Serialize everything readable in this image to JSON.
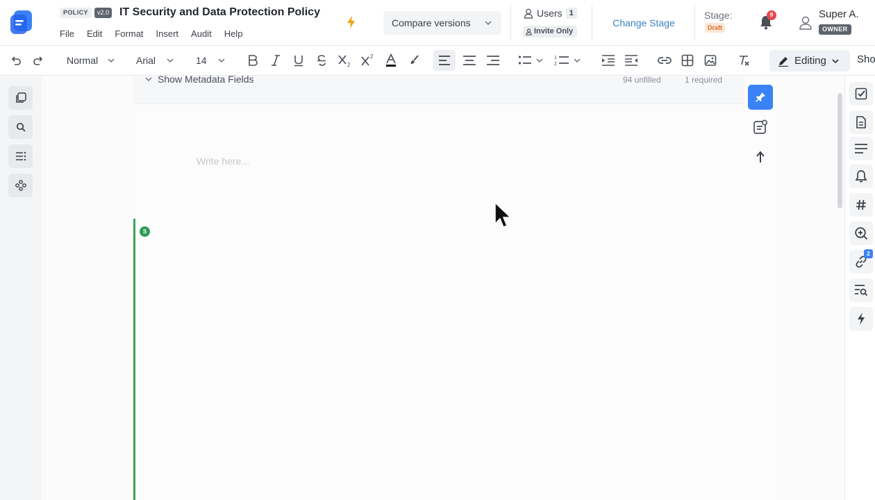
{
  "app": {
    "logo_icon": "document-logo-icon",
    "brand_color": "#3b82f6"
  },
  "document": {
    "type_badge": "POLICY",
    "version": "v2.0",
    "title": "IT Security and Data Protection Policy"
  },
  "menu": {
    "items": [
      "File",
      "Edit",
      "Format",
      "Insert",
      "Audit",
      "Help"
    ]
  },
  "header": {
    "compare_label": "Compare versions",
    "users_label": "Users",
    "users_count": "1",
    "invite_label": "Invite Only",
    "change_stage_label": "Change Stage",
    "stage_label": "Stage:",
    "stage_value": "Draft",
    "notifications_count": "9",
    "user_name": "Super A.",
    "user_role": "OWNER"
  },
  "toolbar": {
    "style_value": "Normal",
    "font_value": "Arial",
    "size_value": "14",
    "mode_label": "Editing",
    "show_label": "Sho"
  },
  "editor": {
    "metadata_toggle": "Show Metadata Fields",
    "unfilled_count": "94 unfilled",
    "required_count": "1 required",
    "placeholder": "Write here...",
    "author_initial": "S"
  },
  "right_rail": {
    "links_count": "2"
  },
  "colors": {
    "accent": "#3b82f6",
    "stage_draft": "#d9702a",
    "notification": "#e5484d",
    "author_line": "#3ba55c"
  }
}
